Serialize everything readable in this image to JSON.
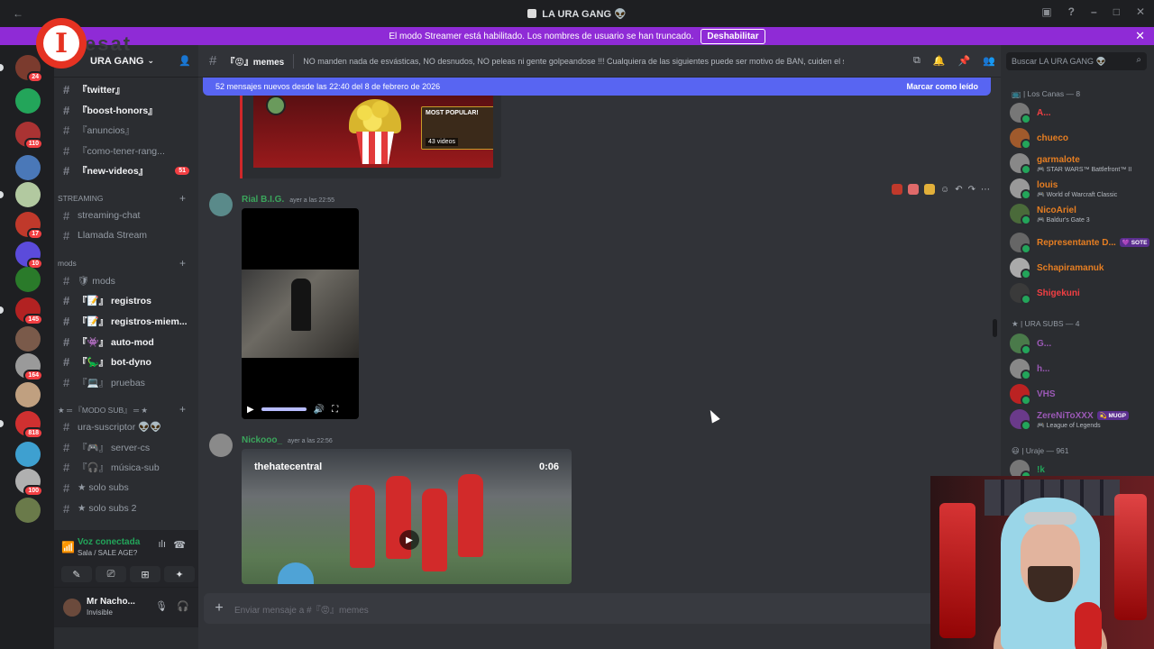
{
  "window": {
    "title": "LA URA GANG 👽",
    "back": "←"
  },
  "banner": {
    "text": "El modo Streamer está habilitado. Los nombres de usuario se han truncado.",
    "button": "Deshabilitar"
  },
  "watermark": {
    "logo_letter": "I",
    "text": "esat"
  },
  "guild": {
    "name": "URA GANG"
  },
  "servers": [
    {
      "badge": "24",
      "color": "#7b3b2e"
    },
    {
      "badge": "",
      "color": "#23a55a"
    },
    {
      "badge": "110",
      "color": "#aa3333"
    },
    {
      "badge": "",
      "color": "#4a78b8"
    },
    {
      "badge": "",
      "color": "#b2c9a0"
    },
    {
      "badge": "17",
      "color": "#c0392b"
    },
    {
      "badge": "10",
      "color": "#5b4bdb"
    },
    {
      "badge": "",
      "color": "#2a7a2a"
    },
    {
      "badge": "145",
      "color": "#b22222"
    },
    {
      "badge": "",
      "color": "#7a5a4a"
    },
    {
      "badge": "164",
      "color": "#9a9a9a"
    },
    {
      "badge": "",
      "color": "#c0a080"
    },
    {
      "badge": "818",
      "color": "#d03030"
    },
    {
      "badge": "",
      "color": "#3ea0d0"
    },
    {
      "badge": "100",
      "color": "#b0b0b0"
    },
    {
      "badge": "",
      "color": "#6a7a4a"
    }
  ],
  "channels": {
    "top": [
      {
        "icon": "🐦",
        "label": "『twitter』",
        "badge": ""
      },
      {
        "icon": "💜",
        "label": "『boost-honors』",
        "badge": ""
      },
      {
        "icon": "📢",
        "label": "『anuncios』",
        "badge": ""
      },
      {
        "icon": "✏",
        "label": "『como-tener-rang...",
        "badge": ""
      },
      {
        "icon": "📺",
        "label": "『new-videos』",
        "badge": "51"
      }
    ],
    "streaming_cat": "STREAMING",
    "streaming": [
      {
        "label": "streaming-chat"
      },
      {
        "label": "Llamada Stream"
      }
    ],
    "mods_cat": "mods",
    "mods": [
      {
        "label": "🛡 mods"
      },
      {
        "label": "『📝』 registros"
      },
      {
        "label": "『📝』 registros-miem..."
      },
      {
        "label": "『👾』 auto-mod"
      },
      {
        "label": "『🦕』 bot-dyno"
      },
      {
        "label": "『💻』 pruebas"
      }
    ],
    "modo_cat": "★ ═ 『MODO SUB』 ═ ★",
    "modo": [
      {
        "label": "ura-suscriptor 👽👽"
      },
      {
        "label": "『🎮』 server-cs"
      },
      {
        "label": "『🎧』 música-sub"
      },
      {
        "label": "★ solo subs"
      },
      {
        "label": "★ solo subs 2"
      }
    ]
  },
  "voice": {
    "status": "Voz conectada",
    "room": "Sala / SALE AGE?"
  },
  "user": {
    "name": "Mr Nacho...",
    "status": "Invisible"
  },
  "topbar": {
    "channel": "『😡』memes",
    "topic": "NO manden nada de esvásticas, NO desnudos, NO peleas ni gente golpeandose !!! Cualquiera de las siguientes puede ser motivo de BAN, cuiden el stream!"
  },
  "newbar": {
    "text": "52 mensajes nuevos desde las 22:40 del 8 de febrero de 2026",
    "mark": "Marcar como leído"
  },
  "embed": {
    "most_popular": "MOST POPULAR!",
    "videos": "43 videos"
  },
  "messages": [
    {
      "author": "Rial B.I.G.",
      "time": "ayer a las 22:55",
      "color": "#3ba55c"
    },
    {
      "author": "Nickooo_",
      "time": "ayer a las 22:56",
      "color": "#3ba55c"
    }
  ],
  "video2": {
    "title": "thehatecentral",
    "duration": "0:06"
  },
  "composer": {
    "placeholder": "Enviar mensaje a #『😡』memes"
  },
  "search": {
    "placeholder": "Buscar LA URA GANG 👽"
  },
  "members": {
    "cat1": "📺 | Los Canas — 8",
    "group1": [
      {
        "name": "A...",
        "activity": "",
        "color": "#f23f43",
        "av": "#777"
      },
      {
        "name": "chueco",
        "activity": "",
        "color": "#e67e22",
        "av": "#a05a2c"
      },
      {
        "name": "garmalote",
        "activity": "🎮 STAR WARS™ Battlefront™ II",
        "color": "#e67e22",
        "av": "#888"
      },
      {
        "name": "louis",
        "activity": "🎮 World of Warcraft Classic",
        "color": "#e67e22",
        "av": "#999"
      },
      {
        "name": "NicoAriel",
        "activity": "🎮 Baldur's Gate 3",
        "color": "#e67e22",
        "av": "#4a6a3a"
      },
      {
        "name": "Representante D...",
        "activity": "",
        "color": "#e67e22",
        "av": "#666",
        "tag": "💜 SOTE"
      },
      {
        "name": "Schapiramanuk",
        "activity": "",
        "color": "#e67e22",
        "av": "#aaa"
      },
      {
        "name": "Shigekuni",
        "activity": "",
        "color": "#f23f43",
        "av": "#3a3a3a"
      }
    ],
    "cat2": "★ | URA SUBS — 4",
    "group2": [
      {
        "name": "G...",
        "activity": "",
        "color": "#9b59b6",
        "av": "#4a7a4a"
      },
      {
        "name": "h...",
        "activity": "",
        "color": "#9b59b6",
        "av": "#888"
      },
      {
        "name": "VHS",
        "activity": "",
        "color": "#9b59b6",
        "av": "#b22"
      },
      {
        "name": "ZereNiToXXX",
        "activity": "🎮 League of Legends",
        "color": "#9b59b6",
        "av": "#6a3a8a",
        "tag": "💫 MUGP"
      }
    ],
    "cat3": "😃 | Uraje — 961",
    "group3": [
      {
        "name": "!k",
        "activity": "",
        "color": "#23a55a",
        "av": "#777"
      }
    ]
  }
}
